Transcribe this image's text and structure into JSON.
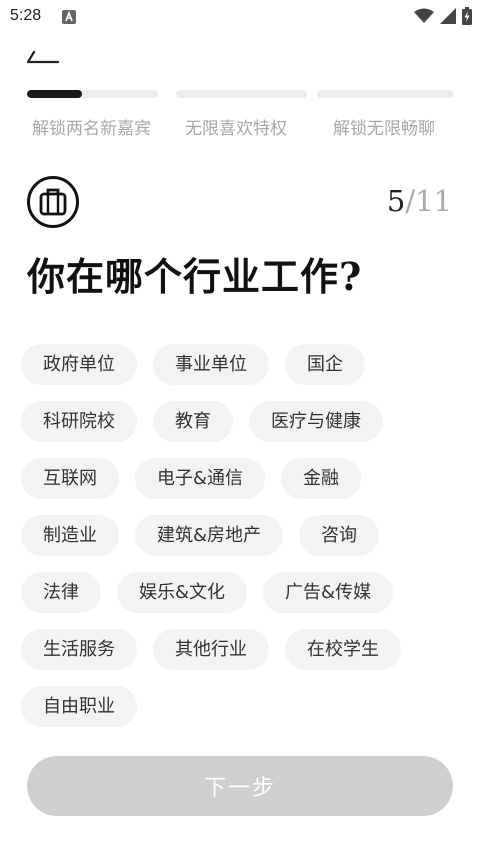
{
  "status_bar": {
    "time": "5:28",
    "notification_icon": "a-badge-icon",
    "icons": [
      "wifi-icon",
      "signal-icon",
      "battery-charging-icon"
    ]
  },
  "header": {
    "back_icon": "back-arrow-icon"
  },
  "progress": {
    "steps": [
      {
        "label": "解锁两名新嘉宾",
        "fill": 0.42
      },
      {
        "label": "无限喜欢特权",
        "fill": 0
      },
      {
        "label": "解锁无限畅聊",
        "fill": 0
      }
    ],
    "fill_color": "#1a1a1a",
    "track_color": "#ececec"
  },
  "question": {
    "icon": "briefcase-icon",
    "current": "5",
    "separator": "/",
    "total": "11",
    "title": "你在哪个行业工作?"
  },
  "options": [
    [
      "政府单位",
      "事业单位",
      "国企"
    ],
    [
      "科研院校",
      "教育",
      "医疗与健康"
    ],
    [
      "互联网",
      "电子&通信",
      "金融"
    ],
    [
      "制造业",
      "建筑&房地产",
      "咨询"
    ],
    [
      "法律",
      "娱乐&文化",
      "广告&传媒"
    ],
    [
      "生活服务",
      "其他行业",
      "在校学生"
    ],
    [
      "自由职业"
    ]
  ],
  "next_button": {
    "label": "下一步",
    "state": "disabled",
    "color": "#cfcfcf"
  }
}
